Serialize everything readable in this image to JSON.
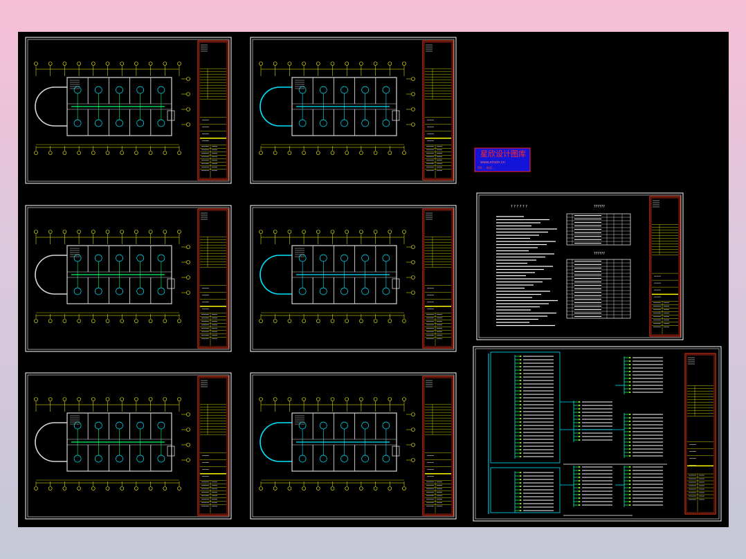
{
  "watermark": {
    "title": "星欣设计图库",
    "subtitle": "www.xinxin.cn",
    "contact": "QQ:... 电话:...",
    "colors": {
      "box_bg": "#1414d8",
      "box_border": "#ff2020",
      "text": "#ff2a2a"
    }
  },
  "notes_sheet": {
    "left_heading": "? ? ? ? ? ?",
    "right_heading": "??????",
    "mid_heading": "??????"
  },
  "colors": {
    "canvas": "#000000",
    "frame": "#ffffff",
    "title_block": "#ff3a1a",
    "grid_yellow": "#ffff00",
    "wall_cyan": "#00e5ff",
    "wire_green": "#00ff66",
    "wall_white": "#d8d8d8"
  }
}
